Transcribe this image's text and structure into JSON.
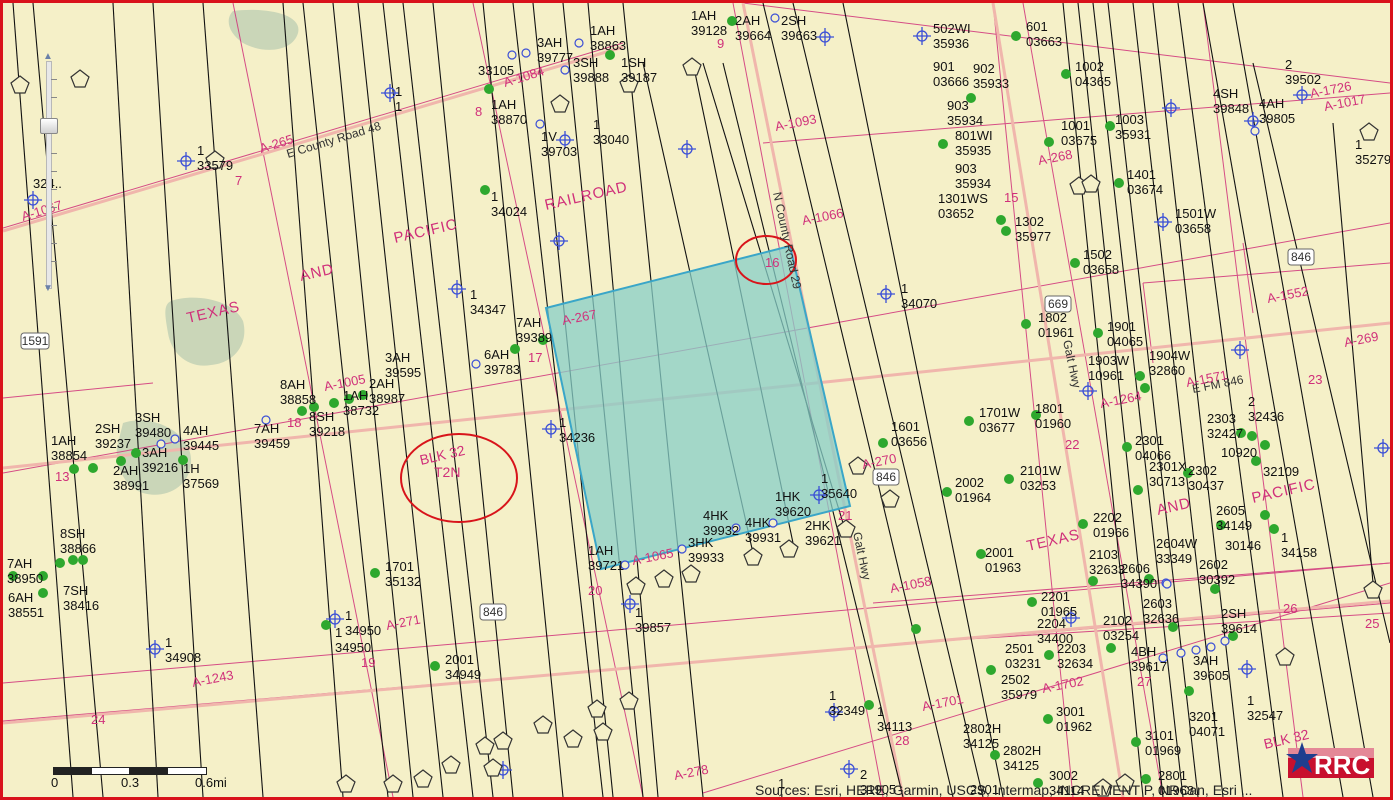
{
  "colors": {
    "background": "#f5f0c8",
    "frame_border": "#d9121b",
    "survey_line": "#d0307a",
    "road": "#f2a7a0",
    "well_line": "#111111",
    "selected_tract_fill": "#87cfc8",
    "selected_tract_stroke": "#3aa6c8",
    "well_producing": "#2ea82e",
    "well_permit": "#3b4fd6",
    "annotation_circle": "#d8141b"
  },
  "map": {
    "labels": {
      "railroad": [
        "TEXAS",
        "AND",
        "PACIFIC",
        "RAILROAD"
      ],
      "railroad_east": [
        "TEXAS",
        "AND",
        "PACIFIC"
      ],
      "blk_32": "BLK 32",
      "t2n": "T2N",
      "blk_32_se": "BLK 32"
    },
    "roads": {
      "county_road_48": "E County Road 48",
      "fm_846": "E FM 846",
      "galt_hwy": "Galt Hwy",
      "n_county_road_29": "N County Road 29",
      "hwy_846_a": "846",
      "hwy_846_b": "846",
      "hwy_846_c": "846",
      "hwy_669": "669",
      "hwy_1591": "1591"
    },
    "surveys": [
      "A-265",
      "A-1067",
      "A-1084",
      "A-1093",
      "A-1066",
      "A-267",
      "A-1005",
      "A-268",
      "A-1552",
      "A-269",
      "A-1571",
      "A-1264",
      "A-270",
      "A-1058",
      "A-271",
      "A-1065",
      "A-1243",
      "A-278",
      "A-1701",
      "A-1702",
      "A-1726",
      "A-1017"
    ],
    "sections": [
      "7",
      "8",
      "9",
      "15",
      "16",
      "17",
      "18",
      "19",
      "20",
      "21",
      "22",
      "23",
      "24",
      "25",
      "26",
      "27",
      "28",
      "13"
    ],
    "well_labels": [
      [
        "1AH",
        "38863"
      ],
      [
        "1SH",
        "39187"
      ],
      [
        "3AH",
        "39777"
      ],
      [
        "3SH",
        "39888"
      ],
      [
        "33105",
        ""
      ],
      [
        "1AH",
        "38870"
      ],
      [
        "1",
        "33040"
      ],
      [
        "1V",
        "39703"
      ],
      [
        "1",
        "33579"
      ],
      [
        "1",
        "34024"
      ],
      [
        "1",
        "34347"
      ],
      [
        "7AH",
        "39389"
      ],
      [
        "6AH",
        "39783"
      ],
      [
        "3AH",
        "39595"
      ],
      [
        "2AH",
        "38987"
      ],
      [
        "8AH",
        "38858"
      ],
      [
        "1AH",
        "38732"
      ],
      [
        "8SH",
        "39218"
      ],
      [
        "7AH",
        "39459"
      ],
      [
        "3SH",
        "39480"
      ],
      [
        "4AH",
        "39445"
      ],
      [
        "2SH",
        "39237"
      ],
      [
        "3AH",
        "39216"
      ],
      [
        "1AH",
        "38854"
      ],
      [
        "2AH",
        "38991"
      ],
      [
        "1H",
        "37569"
      ],
      [
        "1",
        "34236"
      ],
      [
        "1",
        "34070"
      ],
      [
        "1AH",
        "39128"
      ],
      [
        "2AH",
        "39664"
      ],
      [
        "2SH",
        "39663"
      ],
      [
        "502WI",
        "35936"
      ],
      [
        "601",
        "03663"
      ],
      [
        "901",
        "03666"
      ],
      [
        "902",
        "35933"
      ],
      [
        "1002",
        "04365"
      ],
      [
        "903",
        "35934"
      ],
      [
        "801WI",
        "35935"
      ],
      [
        "903",
        "35934"
      ],
      [
        "1001",
        "03675"
      ],
      [
        "1003",
        "35931"
      ],
      [
        "1401",
        "03674"
      ],
      [
        "1301WS",
        "03652"
      ],
      [
        "1302",
        "35977"
      ],
      [
        "1501W",
        "03658"
      ],
      [
        "1502",
        "03658"
      ],
      [
        "1802",
        "01961"
      ],
      [
        "1901",
        "04065"
      ],
      [
        "1903W",
        "10961"
      ],
      [
        "1904W",
        "32860"
      ],
      [
        "2",
        "39502"
      ],
      [
        "4SH",
        "39848"
      ],
      [
        "4AH",
        "39805"
      ],
      [
        "1",
        "35279"
      ],
      [
        "1601",
        "03656"
      ],
      [
        "1701W",
        "03677"
      ],
      [
        "1801",
        "01960"
      ],
      [
        "1HK",
        "39620"
      ],
      [
        "4HK",
        "39932"
      ],
      [
        "4HK",
        "39931"
      ],
      [
        "3HK",
        "39933"
      ],
      [
        "2HK",
        "39621"
      ],
      [
        "1AH",
        "39721"
      ],
      [
        "1",
        "39857"
      ],
      [
        "1",
        "35640"
      ],
      [
        "2002",
        "01964"
      ],
      [
        "2101W",
        "03253"
      ],
      [
        "2202",
        "01966"
      ],
      [
        "2001",
        "01963"
      ],
      [
        "2103",
        "32633"
      ],
      [
        "2201",
        "01965"
      ],
      [
        "2204",
        "34400"
      ],
      [
        "2501",
        "03231"
      ],
      [
        "2502",
        "35979"
      ],
      [
        "2203",
        "32634"
      ],
      [
        "2303",
        "32427"
      ],
      [
        "2",
        "32436"
      ],
      [
        "10920",
        ""
      ],
      [
        "32109",
        ""
      ],
      [
        "2301",
        "04066"
      ],
      [
        "2301X",
        "30713"
      ],
      [
        "2302",
        "30437"
      ],
      [
        "2605",
        "34149"
      ],
      [
        "1",
        "34158"
      ],
      [
        "2604W",
        "33349"
      ],
      [
        "30146",
        ""
      ],
      [
        "2602",
        "30392"
      ],
      [
        "2606",
        "34390"
      ],
      [
        "2603",
        "32636"
      ],
      [
        "2102",
        "03254"
      ],
      [
        "4BH",
        "39617"
      ],
      [
        "2SH",
        "39614"
      ],
      [
        "3AH",
        "39605"
      ],
      [
        "1",
        "32547"
      ],
      [
        "3201",
        "04071"
      ],
      [
        "3001",
        "01962"
      ],
      [
        "3101",
        "01969"
      ],
      [
        "2802H",
        "34125"
      ],
      [
        "2802H",
        "34125"
      ],
      [
        "3002",
        "34114"
      ],
      [
        "2801",
        "01968"
      ],
      [
        "2901",
        ""
      ],
      [
        "1",
        "32349"
      ],
      [
        "1",
        "34113"
      ],
      [
        "2",
        "31905"
      ],
      [
        "1",
        "1"
      ],
      [
        "1701",
        "35132"
      ],
      [
        "1",
        "34950"
      ],
      [
        "1",
        "34950"
      ],
      [
        "2001",
        "34949"
      ],
      [
        "1",
        "34908"
      ],
      [
        "7AH",
        "38950"
      ],
      [
        "8SH",
        "38866"
      ],
      [
        "7SH",
        "38416"
      ],
      [
        "6AH",
        "38551"
      ],
      [
        "324..",
        ""
      ],
      [
        "1",
        "1"
      ]
    ]
  },
  "zoom_slider": {
    "up_icon": "▲",
    "down_icon": "▼"
  },
  "scalebar": {
    "labels": [
      "0",
      "0.3",
      "0.6mi"
    ]
  },
  "attribution": "Sources: Esri, HERE, Garmin, USGS, Intermap, INCREMENT P, NRCan, Esri ...",
  "logo": {
    "text": "RRC"
  }
}
